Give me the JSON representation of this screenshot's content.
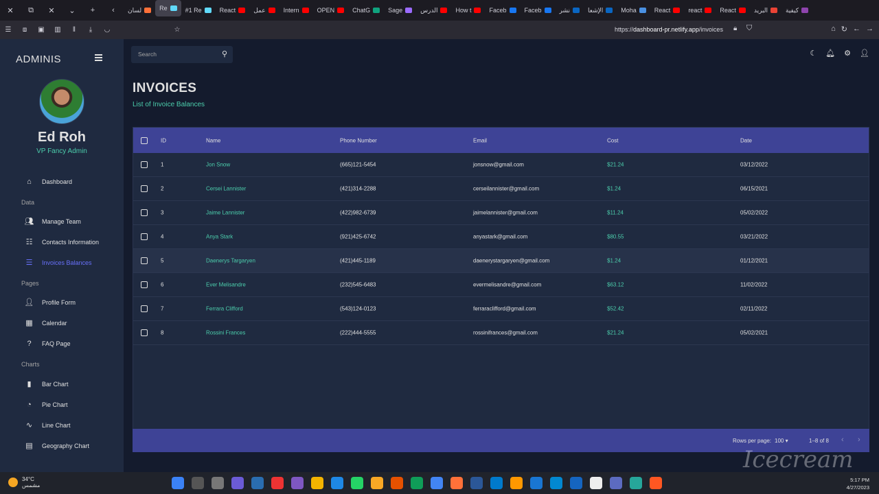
{
  "browser": {
    "tabs": [
      "لسان",
      "Re",
      "#1 Re",
      "React",
      "عمل",
      "Intern",
      "OPEN",
      "ChatG",
      "Sage",
      "الدرس",
      "How t",
      "Faceb",
      "Faceb",
      "نشر",
      "الإشعا",
      "Moha",
      "React",
      "react",
      "React",
      "البريد",
      "كيفية"
    ],
    "url_prefix": "https://",
    "url_host": "dashboard-pr.netlify.app",
    "url_path": "/invoices"
  },
  "sidebar": {
    "brand": "ADMINIS",
    "user_name": "Ed Roh",
    "user_role": "VP Fancy Admin",
    "items": [
      {
        "label": "Dashboard",
        "icon": "home-icon"
      },
      {
        "section": "Data"
      },
      {
        "label": "Manage Team",
        "icon": "people-icon"
      },
      {
        "label": "Contacts Information",
        "icon": "contacts-icon"
      },
      {
        "label": "Invoices Balances",
        "icon": "receipt-icon",
        "active": true
      },
      {
        "section": "Pages"
      },
      {
        "label": "Profile Form",
        "icon": "person-icon"
      },
      {
        "label": "Calendar",
        "icon": "calendar-icon"
      },
      {
        "label": "FAQ Page",
        "icon": "help-icon"
      },
      {
        "section": "Charts"
      },
      {
        "label": "Bar Chart",
        "icon": "bar-chart-icon"
      },
      {
        "label": "Pie Chart",
        "icon": "pie-chart-icon"
      },
      {
        "label": "Line Chart",
        "icon": "line-chart-icon"
      },
      {
        "label": "Geography Chart",
        "icon": "map-icon"
      }
    ]
  },
  "topbar": {
    "search_placeholder": "Search"
  },
  "header": {
    "title": "INVOICES",
    "subtitle": "List of Invoice Balances"
  },
  "grid": {
    "columns": [
      "ID",
      "Name",
      "Phone Number",
      "Email",
      "Cost",
      "Date"
    ],
    "rows": [
      {
        "id": "1",
        "name": "Jon Snow",
        "phone": "(665)121-5454",
        "email": "jonsnow@gmail.com",
        "cost": "$21.24",
        "date": "03/12/2022"
      },
      {
        "id": "2",
        "name": "Cersei Lannister",
        "phone": "(421)314-2288",
        "email": "cerseilannister@gmail.com",
        "cost": "$1.24",
        "date": "06/15/2021"
      },
      {
        "id": "3",
        "name": "Jaime Lannister",
        "phone": "(422)982-6739",
        "email": "jaimelannister@gmail.com",
        "cost": "$11.24",
        "date": "05/02/2022"
      },
      {
        "id": "4",
        "name": "Anya Stark",
        "phone": "(921)425-6742",
        "email": "anyastark@gmail.com",
        "cost": "$80.55",
        "date": "03/21/2022"
      },
      {
        "id": "5",
        "name": "Daenerys Targaryen",
        "phone": "(421)445-1189",
        "email": "daenerystargaryen@gmail.com",
        "cost": "$1.24",
        "date": "01/12/2021"
      },
      {
        "id": "6",
        "name": "Ever Melisandre",
        "phone": "(232)545-6483",
        "email": "evermelisandre@gmail.com",
        "cost": "$63.12",
        "date": "11/02/2022"
      },
      {
        "id": "7",
        "name": "Ferrara Clifford",
        "phone": "(543)124-0123",
        "email": "ferraraclifford@gmail.com",
        "cost": "$52.42",
        "date": "02/11/2022"
      },
      {
        "id": "8",
        "name": "Rossini Frances",
        "phone": "(222)444-5555",
        "email": "rossinifrances@gmail.com",
        "cost": "$21.24",
        "date": "05/02/2021"
      }
    ],
    "footer": {
      "rows_per_page_label": "Rows per page:",
      "rows_per_page_value": "100",
      "range": "1–8 of 8"
    }
  },
  "taskbar": {
    "temperature": "34°C",
    "weather_label": "مشمس",
    "time": "5:17 PM",
    "date": "4/27/2023"
  },
  "watermark": "Icecream",
  "colors": {
    "accent_green": "#4cceac",
    "header_blue": "#3e4396",
    "active_nav": "#6870fa",
    "panel": "#1f2a40",
    "background": "#141b2d"
  }
}
